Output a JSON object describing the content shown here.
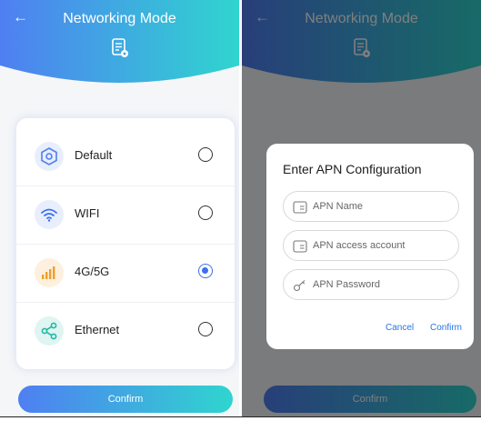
{
  "colors": {
    "primary": "#3a6ff0",
    "gradient_start": "#4f7ff2",
    "gradient_end": "#2fd5cf",
    "dialog_link": "#2a72e8"
  },
  "header": {
    "title": "Networking Mode",
    "back_icon": "arrow-left-icon",
    "doc_icon": "document-settings-icon"
  },
  "options": [
    {
      "label": "Default",
      "icon": "gear-hexagon-icon",
      "selected": false
    },
    {
      "label": "WIFI",
      "icon": "wifi-icon",
      "selected": false
    },
    {
      "label": "4G/5G",
      "icon": "signal-bars-icon",
      "selected": true
    },
    {
      "label": "Ethernet",
      "icon": "share-nodes-icon",
      "selected": false
    }
  ],
  "confirm_label": "Confirm",
  "dialog": {
    "title": "Enter APN Configuration",
    "fields": [
      {
        "placeholder": "APN Name",
        "icon": "card-icon"
      },
      {
        "placeholder": "APN access account",
        "icon": "card-icon"
      },
      {
        "placeholder": "APN Password",
        "icon": "key-icon"
      }
    ],
    "cancel_label": "Cancel",
    "confirm_label": "Confirm"
  }
}
